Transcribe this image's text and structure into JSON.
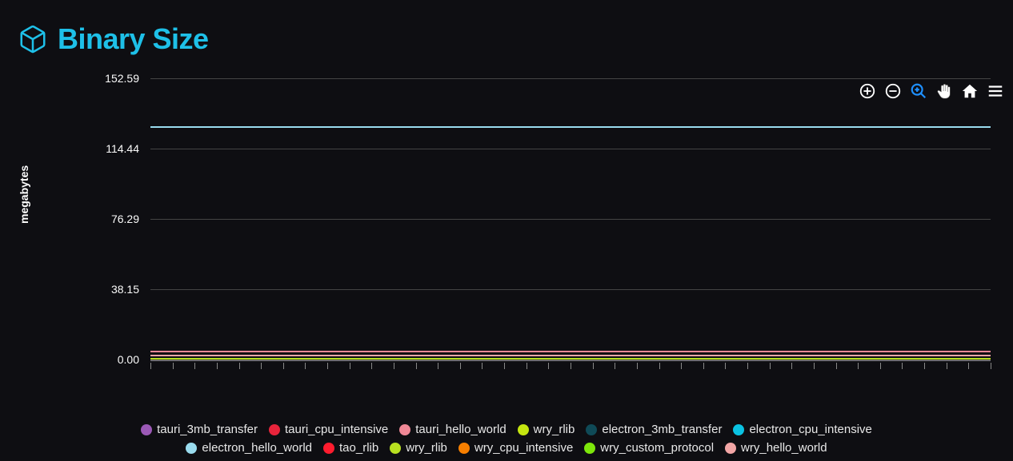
{
  "header": {
    "title": "Binary Size"
  },
  "toolbar": {
    "zoom_in": "Zoom In",
    "zoom_out": "Zoom Out",
    "zoom_select": "Selection Zoom",
    "pan": "Panning",
    "home": "Reset Zoom",
    "menu": "Menu"
  },
  "chart_data": {
    "type": "line",
    "title": "Binary Size",
    "ylabel": "megabytes",
    "xlabel": "",
    "ylim": [
      0,
      152.59
    ],
    "yticks": [
      0.0,
      38.15,
      76.29,
      114.44,
      152.59
    ],
    "ytick_labels": [
      "0.00",
      "38.15",
      "76.29",
      "114.44",
      "152.59"
    ],
    "x_points": 38,
    "series": [
      {
        "name": "tauri_3mb_transfer",
        "color": "#9b59b6",
        "value": 4.8
      },
      {
        "name": "tauri_cpu_intensive",
        "color": "#e8243b",
        "value": 4.8
      },
      {
        "name": "tauri_hello_world",
        "color": "#f08896",
        "value": 4.6
      },
      {
        "name": "wry_rlib",
        "color": "#c5e610",
        "value": 0.7
      },
      {
        "name": "electron_3mb_transfer",
        "color": "#0f4a57",
        "value": 126.7
      },
      {
        "name": "electron_cpu_intensive",
        "color": "#0ac2e2",
        "value": 126.7
      },
      {
        "name": "electron_hello_world",
        "color": "#99dbee",
        "value": 126.7
      },
      {
        "name": "tao_rlib",
        "color": "#ff1c2e",
        "value": 0.5
      },
      {
        "name": "wry_rlib",
        "color": "#b8e020",
        "value": 0.7
      },
      {
        "name": "wry_cpu_intensive",
        "color": "#f77f00",
        "value": 2.4
      },
      {
        "name": "wry_custom_protocol",
        "color": "#7de60b",
        "value": 2.4
      },
      {
        "name": "wry_hello_world",
        "color": "#f2a6a6",
        "value": 2.4
      }
    ]
  }
}
